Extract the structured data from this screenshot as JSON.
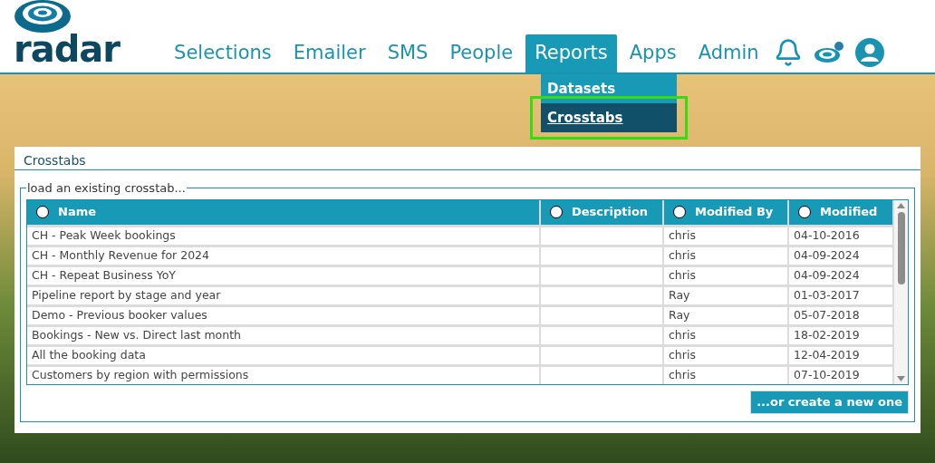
{
  "brand": {
    "name": "radar"
  },
  "nav": [
    {
      "label": "Selections",
      "selected": false
    },
    {
      "label": "Emailer",
      "selected": false
    },
    {
      "label": "SMS",
      "selected": false
    },
    {
      "label": "People",
      "selected": false
    },
    {
      "label": "Reports",
      "selected": true
    },
    {
      "label": "Apps",
      "selected": false
    },
    {
      "label": "Admin",
      "selected": false
    }
  ],
  "dropdown": [
    {
      "label": "Datasets",
      "selected": false,
      "highlighted": false
    },
    {
      "label": "Crosstabs",
      "selected": true,
      "highlighted": true
    }
  ],
  "panel": {
    "title": "Crosstabs",
    "legend": "load an existing crosstab...",
    "button": "...or create a new one"
  },
  "table": {
    "columns": [
      {
        "label": "Name",
        "selected": false
      },
      {
        "label": "Description",
        "selected": false
      },
      {
        "label": "Modified By",
        "selected": false
      },
      {
        "label": "Modified",
        "selected": false
      }
    ],
    "rows": [
      [
        "CH - Peak Week bookings",
        "",
        "chris",
        "04-10-2016"
      ],
      [
        "CH - Monthly Revenue for 2024",
        "",
        "chris",
        "04-09-2024"
      ],
      [
        "CH - Repeat Business YoY",
        "",
        "chris",
        "04-09-2024"
      ],
      [
        "Pipeline report by stage and year",
        "",
        "Ray",
        "01-03-2017"
      ],
      [
        "Demo - Previous booker values",
        "",
        "Ray",
        "05-07-2018"
      ],
      [
        "Bookings - New vs. Direct last month",
        "",
        "chris",
        "18-02-2019"
      ],
      [
        "All the booking data",
        "",
        "chris",
        "12-04-2019"
      ],
      [
        "Customers by region with permissions",
        "",
        "chris",
        "07-10-2019"
      ]
    ]
  }
}
